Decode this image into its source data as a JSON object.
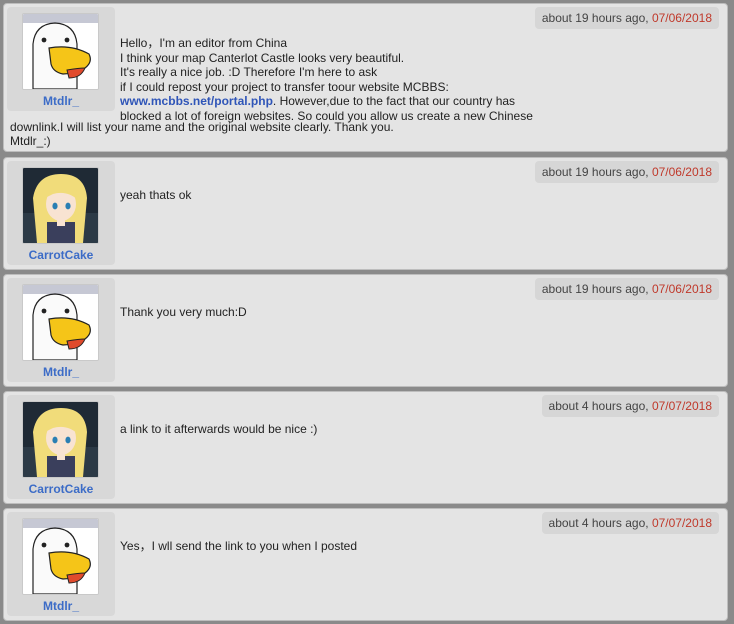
{
  "messages": [
    {
      "user": "Mtdlr_",
      "avatar": "goose-avatar",
      "time_prefix": "about 19 hours ago, ",
      "date": "07/06/2018",
      "text_lines": [
        "Hello，I'm an editor from China",
        "I think your map Canterlot Castle looks very beautiful.",
        "It's really a nice job. :D Therefore I'm here to ask",
        "if I could repost your project to transfer toour website MCBBS:"
      ],
      "link": "www.mcbbs.net/portal.php",
      "link_after": ". However,due to the fact that our country has",
      "line6": "blocked a lot of foreign websites. So could you allow us create a new Chinese",
      "line7": "downlink.I will list your name and the original website clearly. Thank you.",
      "line8": "Mtdlr_:)"
    },
    {
      "user": "CarrotCake",
      "avatar": "anime-girl-avatar",
      "time_prefix": "about 19 hours ago, ",
      "date": "07/06/2018",
      "text": "yeah thats ok"
    },
    {
      "user": "Mtdlr_",
      "avatar": "goose-avatar",
      "time_prefix": "about 19 hours ago, ",
      "date": "07/06/2018",
      "text": "Thank you very much:D"
    },
    {
      "user": "CarrotCake",
      "avatar": "anime-girl-avatar",
      "time_prefix": "about 4 hours ago, ",
      "date": "07/07/2018",
      "text": "a link to it afterwards would be nice :)"
    },
    {
      "user": "Mtdlr_",
      "avatar": "goose-avatar",
      "time_prefix": "about 4 hours ago, ",
      "date": "07/07/2018",
      "text": "Yes，I wll send the link to you when I posted"
    }
  ],
  "colors": {
    "username": "#3c6cc7",
    "date": "#c0392b",
    "link": "#2f55b8",
    "panel": "#e4e4e4",
    "page_bg": "#8a8a8a"
  }
}
